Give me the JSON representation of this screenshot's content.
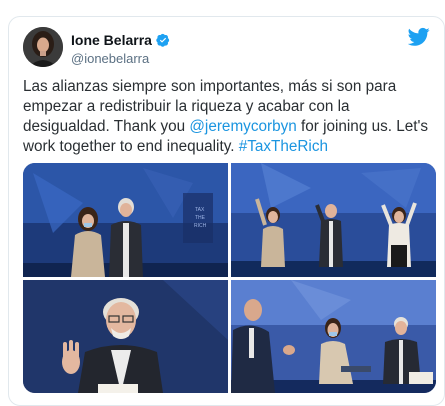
{
  "author": {
    "name": "Ione Belarra",
    "handle": "@ionebelarra",
    "verified": true
  },
  "tweet": {
    "text_before": "Las alianzas siempre son importantes, más si son para empezar a redistribuir la riqueza y acabar con la desigualdad. Thank you ",
    "mention": "@jeremycorbyn",
    "text_middle": " for joining us. Let's work together to end inequality. ",
    "hashtag": "#TaxTheRich"
  },
  "media": {
    "photos": [
      {
        "description": "stage-two-people"
      },
      {
        "description": "stage-waving"
      },
      {
        "description": "speaker-closeup"
      },
      {
        "description": "panel-seated"
      }
    ]
  },
  "icons": {
    "verified": "verified-badge-icon",
    "twitter": "twitter-bird-icon"
  },
  "colors": {
    "brand": "#1da1f2",
    "link": "#1b95e0",
    "handle": "#5b7083"
  }
}
